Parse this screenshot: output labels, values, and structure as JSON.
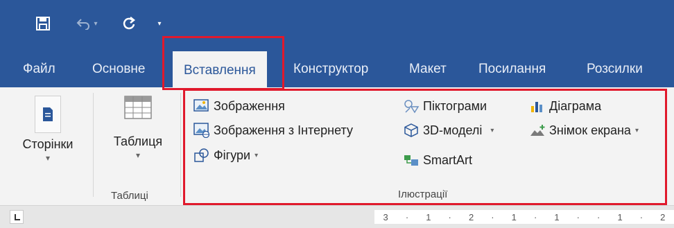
{
  "colors": {
    "accent": "#2b579a",
    "highlight": "#e0192c"
  },
  "quick_access": [
    {
      "name": "save-icon"
    },
    {
      "name": "undo-icon"
    },
    {
      "name": "redo-icon"
    },
    {
      "name": "customize-icon"
    }
  ],
  "tabs": [
    {
      "label": "Файл"
    },
    {
      "label": "Основне"
    },
    {
      "label": "Вставлення",
      "active": true
    },
    {
      "label": "Конструктор"
    },
    {
      "label": "Макет"
    },
    {
      "label": "Посилання"
    },
    {
      "label": "Розсилки"
    }
  ],
  "ribbon": {
    "pages": {
      "label": "Сторінки"
    },
    "tables": {
      "button_label": "Таблиця",
      "group_label": "Таблиці"
    },
    "illustrations": {
      "group_label": "Ілюстрації",
      "pictures": "Зображення",
      "online_pictures": "Зображення з Інтернету",
      "shapes": "Фігури",
      "icons": "Піктограми",
      "models_3d": "3D-моделі",
      "smartart": "SmartArt",
      "chart": "Діаграма",
      "screenshot": "Знімок екрана"
    }
  },
  "ruler": {
    "marks": [
      "3",
      "·",
      "1",
      "·",
      "2",
      "·",
      "1",
      "·",
      "1",
      "·",
      "·",
      "1",
      "·",
      "2"
    ]
  }
}
